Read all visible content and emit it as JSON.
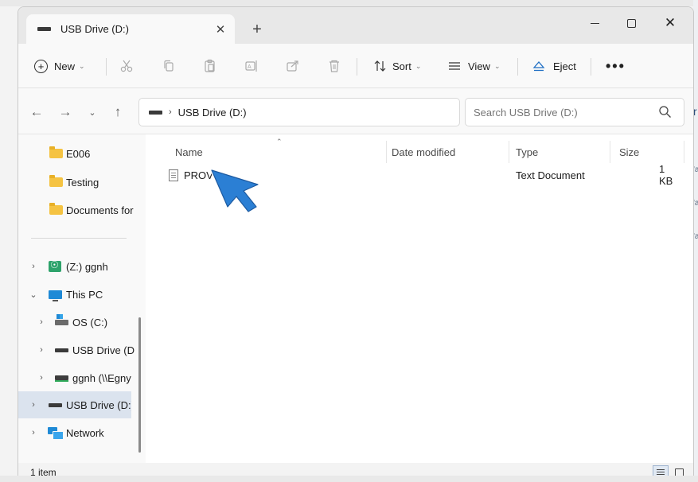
{
  "window": {
    "tab_title": "USB Drive (D:)",
    "tab_close": "✕",
    "new_tab": "+",
    "close": "✕"
  },
  "commandbar": {
    "new_label": "New",
    "sort_label": "Sort",
    "view_label": "View",
    "eject_label": "Eject",
    "more_label": "•••"
  },
  "address": {
    "path": "USB Drive (D:)",
    "search_placeholder": "Search USB Drive (D:)"
  },
  "sidebar": {
    "items": [
      {
        "label": "E006",
        "icon": "folder-icon"
      },
      {
        "label": "Testing",
        "icon": "folder-icon"
      },
      {
        "label": "Documents for",
        "icon": "folder-icon"
      },
      {
        "label": "(Z:) ggnh",
        "icon": "network-drive-icon"
      },
      {
        "label": "This PC",
        "icon": "monitor-icon"
      },
      {
        "label": "OS (C:)",
        "icon": "os-drive-icon"
      },
      {
        "label": "USB Drive (D",
        "icon": "usb-drive-icon"
      },
      {
        "label": "ggnh (\\\\Egny",
        "icon": "network-share-icon"
      },
      {
        "label": "USB Drive (D:)",
        "icon": "usb-drive-icon",
        "selected": true
      },
      {
        "label": "Network",
        "icon": "network-icon"
      }
    ]
  },
  "columns": {
    "name": "Name",
    "date_modified": "Date modified",
    "type": "Type",
    "size": "Size"
  },
  "files": [
    {
      "name": "PROV",
      "date_modified": "",
      "type": "Text Document",
      "size": "1 KB"
    }
  ],
  "status": {
    "item_count": "1 item"
  },
  "background_right": [
    "r",
    "'a",
    "'a",
    "'a"
  ]
}
